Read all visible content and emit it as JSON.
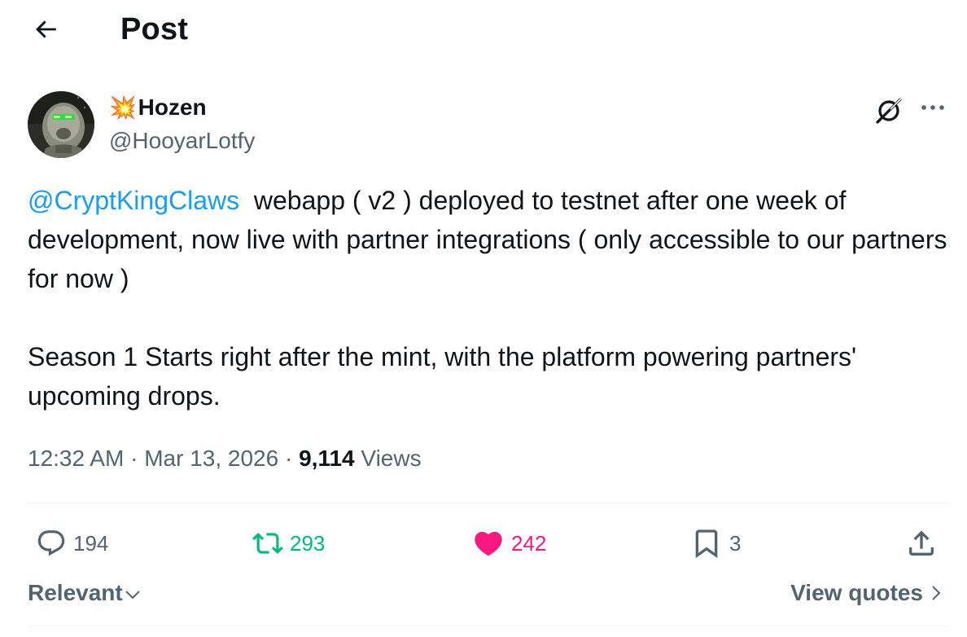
{
  "header": {
    "title": "Post",
    "back_icon": "arrow-left-icon"
  },
  "author": {
    "emoji": "💥",
    "name": "Hozen",
    "handle": "@HooyarLotfy",
    "avatar_icon": "avatar-image"
  },
  "top_actions": {
    "grok_icon": "grok-icon",
    "more_icon": "more-horizontal-icon"
  },
  "post": {
    "mention": "@CryptKingClaws",
    "line1_rest": "  webapp ( v2 ) deployed to testnet after one week of development, now live with partner integrations ( only accessible to our partners for now )",
    "paragraph2": "Season 1 Starts right after the mint, with the platform powering partners' upcoming drops."
  },
  "meta": {
    "time": "12:32 AM",
    "separator": " · ",
    "date": "Mar 13, 2026",
    "views_count": "9,114",
    "views_label": " Views"
  },
  "actions": {
    "reply_count": "194",
    "retweet_count": "293",
    "like_count": "242",
    "bookmark_count": "3"
  },
  "colors": {
    "text_primary": "#0f1419",
    "text_secondary": "#536471",
    "link": "#1d9bf0",
    "retweet": "#00ba7c",
    "like": "#f91880",
    "divider": "#eff3f4"
  },
  "footer": {
    "sort_label": "Relevant",
    "view_quotes_label": "View quotes"
  }
}
